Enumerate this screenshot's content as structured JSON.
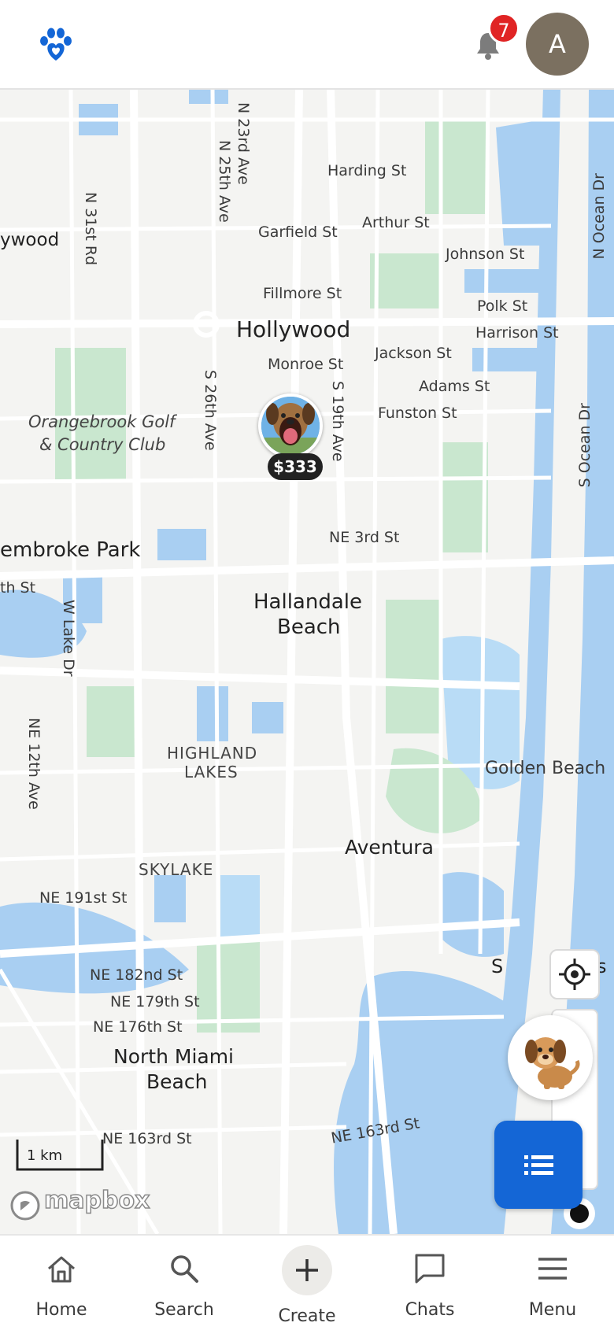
{
  "header": {
    "logo_icon": "paw-heart-icon",
    "notification_count": "7",
    "avatar_initial": "A"
  },
  "map": {
    "labels": {
      "harding_st": "Harding St",
      "arthur_st": "Arthur St",
      "garfield_st": "Garfield St",
      "johnson_st": "Johnson St",
      "fillmore_st": "Fillmore St",
      "polk_st": "Polk St",
      "harrison_st": "Harrison St",
      "hollywood": "Hollywood",
      "jackson_st": "Jackson St",
      "monroe_st": "Monroe St",
      "adams_st": "Adams St",
      "funston_st": "Funston St",
      "orangebrook": "Orangebrook Golf",
      "orangebrook2": "& Country Club",
      "ywood": "ywood",
      "ne_3rd_st": "NE 3rd St",
      "pembroke_park": "embroke Park",
      "th_st": "th St",
      "hallandale": "Hallandale",
      "beach": "Beach",
      "highland": "HIGHLAND",
      "lakes": "LAKES",
      "golden_beach": "Golden Beach",
      "aventura": "Aventura",
      "skylake": "SKYLAKE",
      "ne_191st_st": "NE 191st St",
      "ne_182nd_st": "NE 182nd St",
      "ne_179th_st": "NE 179th St",
      "ne_176th_st": "NE 176th St",
      "north_miami": "North Miami",
      "north_miami2": "Beach",
      "ne_163rd_st": "NE 163rd St",
      "ne_163rd_st2": "NE 163rd St",
      "sunny_s": "S",
      "sunny_end": "s",
      "n_23rd_ave": "N 23rd Ave",
      "n_25th_ave": "N 25th Ave",
      "n_31st_rd": "N 31st Rd",
      "s_26th_ave": "S 26th Ave",
      "s_19th_ave": "S 19th Ave",
      "n_ocean_dr": "N Ocean Dr",
      "s_ocean_dr": "S Ocean Dr",
      "w_lake_dr": "W Lake Dr",
      "ne_12th_ave": "NE 12th Ave"
    },
    "pin_price": "$333",
    "scale": "1 km",
    "attribution": "mapbox"
  },
  "nav": [
    {
      "label": "Home",
      "icon": "home-icon"
    },
    {
      "label": "Search",
      "icon": "search-icon"
    },
    {
      "label": "Create",
      "icon": "plus-icon"
    },
    {
      "label": "Chats",
      "icon": "chat-bubble-icon"
    },
    {
      "label": "Menu",
      "icon": "hamburger-menu-icon"
    }
  ],
  "colors": {
    "water": "#a9cff2",
    "park": "#c9e7cf",
    "primary": "#1466d6",
    "badge": "#e02424"
  }
}
